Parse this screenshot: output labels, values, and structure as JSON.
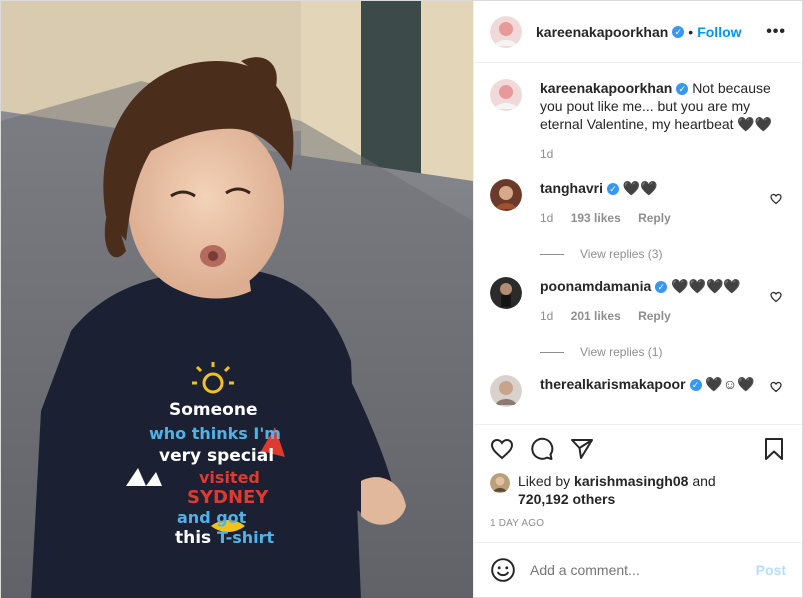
{
  "post": {
    "author": "kareenakapoorkhan",
    "follow_label": "Follow",
    "separator": "•",
    "more_label": "•••",
    "caption": "Not because you pout like me... but you are my eternal Valentine, my heartbeat 🖤🖤",
    "caption_time": "1d"
  },
  "photo": {
    "shirt_text": [
      "Someone",
      "who thinks I'm",
      "very special",
      "visited",
      "SYDNEY",
      "and got",
      "this",
      "T-shirt"
    ]
  },
  "comments": [
    {
      "user": "tanghavri",
      "text": "🖤🖤",
      "time": "1d",
      "likes": "193 likes",
      "reply": "Reply",
      "view_replies": "View replies (3)"
    },
    {
      "user": "poonamdamania",
      "text": "🖤🖤🖤🖤",
      "time": "1d",
      "likes": "201 likes",
      "reply": "Reply",
      "view_replies": "View replies (1)"
    },
    {
      "user": "therealkarismakapoor",
      "text": "🖤☺🖤"
    }
  ],
  "likes": {
    "liked_by_prefix": "Liked by",
    "liked_by_user": "karishmasingh08",
    "and_label": "and",
    "others": "720,192 others"
  },
  "timestamp": "1 DAY AGO",
  "add_comment": {
    "placeholder": "Add a comment...",
    "post_label": "Post"
  },
  "colors": {
    "accent": "#0095f6",
    "verified": "#3897f0",
    "post_disabled": "#b2dffc",
    "muted": "#8e8e8e"
  }
}
